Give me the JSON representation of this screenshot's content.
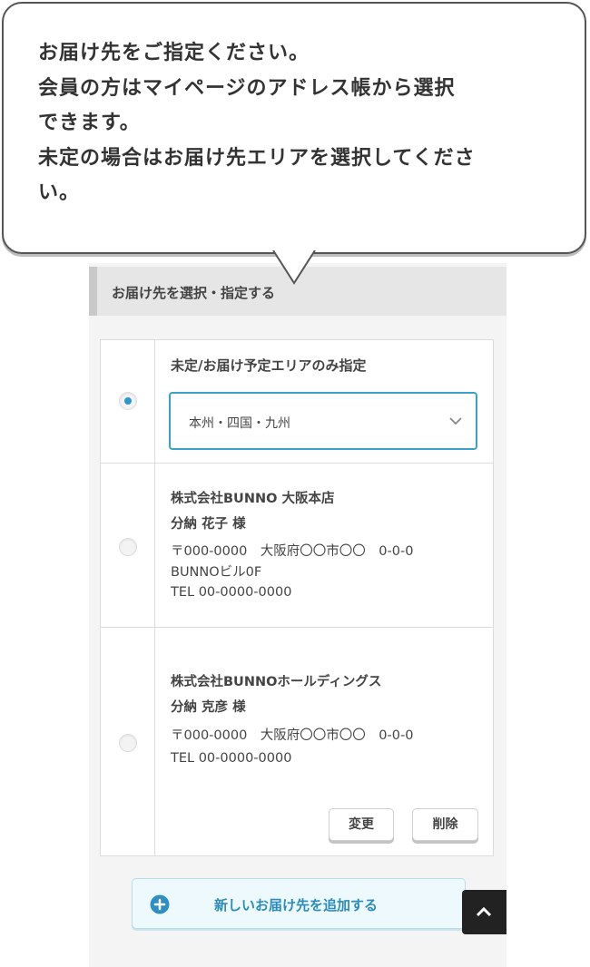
{
  "bubble": {
    "lines": [
      "お届け先をご指定ください。",
      "会員の方はマイページのアドレス帳から選択",
      "できます。",
      "未定の場合はお届け先エリアを選択してくださ",
      "い。"
    ]
  },
  "section": {
    "title": "お届け先を選択・指定する"
  },
  "options": [
    {
      "selected": true,
      "title": "未定/お届け予定エリアのみ指定",
      "area_select": {
        "value": "本州・四国・九州",
        "icon": "chevron-down-icon"
      }
    },
    {
      "selected": false,
      "company": "株式会社BUNNO 大阪本店",
      "name": "分納 花子 様",
      "address_line1": "〒000-0000　大阪府〇〇市〇〇　0-0-0",
      "address_line2": "BUNNOビル0F",
      "tel": "TEL 00-0000-0000"
    },
    {
      "selected": false,
      "company": "株式会社BUNNOホールディングス",
      "name": "分納 克彦 様",
      "address_line1": "〒000-0000　大阪府〇〇市〇〇　0-0-0",
      "tel": "TEL 00-0000-0000",
      "edit_label": "変更",
      "delete_label": "削除"
    }
  ],
  "add_button": {
    "label": "新しいお届け先を追加する",
    "icon": "plus-circle-icon"
  },
  "back_to_top": {
    "icon": "chevron-up-icon"
  },
  "colors": {
    "accent": "#2d98c9",
    "accent_border": "#3ba0c7",
    "add_bg": "#eef9fd"
  }
}
